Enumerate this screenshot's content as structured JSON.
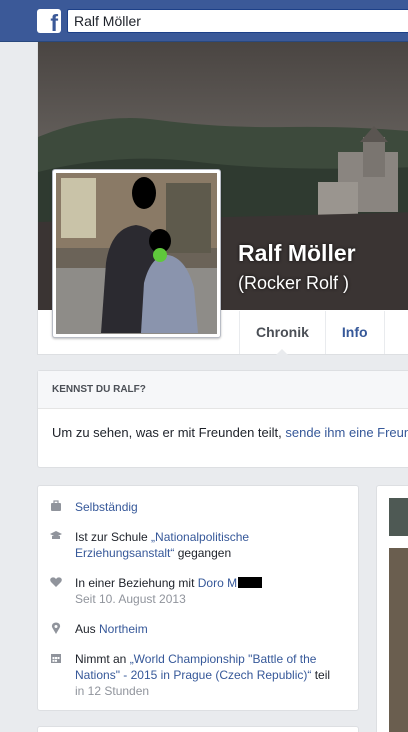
{
  "header": {
    "logo_icon": "facebook-f-icon",
    "search_value": "Ralf Möller"
  },
  "profile": {
    "name": "Ralf Möller",
    "nickname": "(Rocker Rolf )",
    "tabs": [
      "Chronik",
      "Info"
    ]
  },
  "know_card": {
    "heading": "KENNST DU RALF?",
    "text": "Um zu sehen, was er mit Freunden teilt, ",
    "link": "sende ihm eine Freundschaftsanfrage."
  },
  "intro": {
    "work": "Selbständig",
    "school_prefix": "Ist zur Schule ",
    "school_link": "„Nationalpolitische Erziehungsanstalt“",
    "school_suffix": " gegangen",
    "relationship_prefix": "In einer Beziehung mit ",
    "relationship_link": "Doro M",
    "relationship_since": "Seit 10. August 2013",
    "location_prefix": "Aus ",
    "location_link": "Northeim",
    "event_prefix": "Nimmt an ",
    "event_link": "„World Championship \"Battle of the Nations\" - 2015 in Prague (Czech Republic)“",
    "event_suffix": " teil",
    "event_time": "in 12 Stunden"
  },
  "colors": {
    "facebook_blue": "#3b5998",
    "link_blue": "#365899",
    "background": "#e9ebee"
  },
  "icons": [
    "briefcase-icon",
    "graduation-cap-icon",
    "heart-icon",
    "location-pin-icon",
    "calendar-icon"
  ]
}
